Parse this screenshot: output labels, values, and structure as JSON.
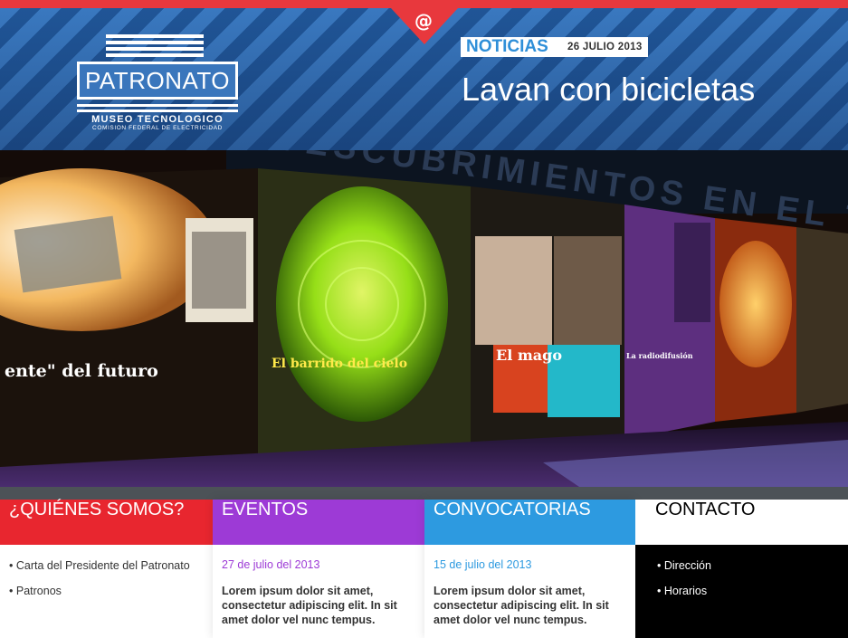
{
  "header": {
    "logo": {
      "name": "PATRONATO",
      "subtitle": "MUSEO TECNOLOGICO",
      "subtitle2": "COMISION FEDERAL DE ELECTRICIDAD"
    },
    "contact_icon": "@",
    "news": {
      "tag": "NOTICIAS",
      "date": "26 JULIO 2013",
      "title": "Lavan con bicicletas"
    }
  },
  "hero": {
    "headlines": [
      "ente\" del futuro",
      "El barrido del cielo",
      "El mago",
      "La radiodifusión"
    ],
    "banner_text": "DESCUBRIMIENTOS EN EL TIEMPO"
  },
  "sections": {
    "quienes": {
      "title": "¿QUIÉNES SOMOS?",
      "items": [
        "Carta del Presidente del Patronato",
        "Patronos"
      ]
    },
    "eventos": {
      "title": "EVENTOS",
      "date": "27 de julio del 2013",
      "text": "Lorem ipsum dolor sit amet, consectetur adipiscing elit. In sit amet dolor vel nunc tempus."
    },
    "convocatorias": {
      "title": "CONVOCATORIAS",
      "date": "15 de julio del 2013",
      "text": "Lorem ipsum dolor sit amet, consectetur adipiscing elit. In sit amet dolor vel nunc tempus."
    },
    "contacto": {
      "title": "CONTACTO",
      "items": [
        "Dirección",
        "Horarios"
      ]
    }
  },
  "colors": {
    "accent_red": "#e8262f",
    "purple": "#9d3ad6",
    "blue": "#2d9ae0",
    "header_blue": "#2f6fb7"
  }
}
